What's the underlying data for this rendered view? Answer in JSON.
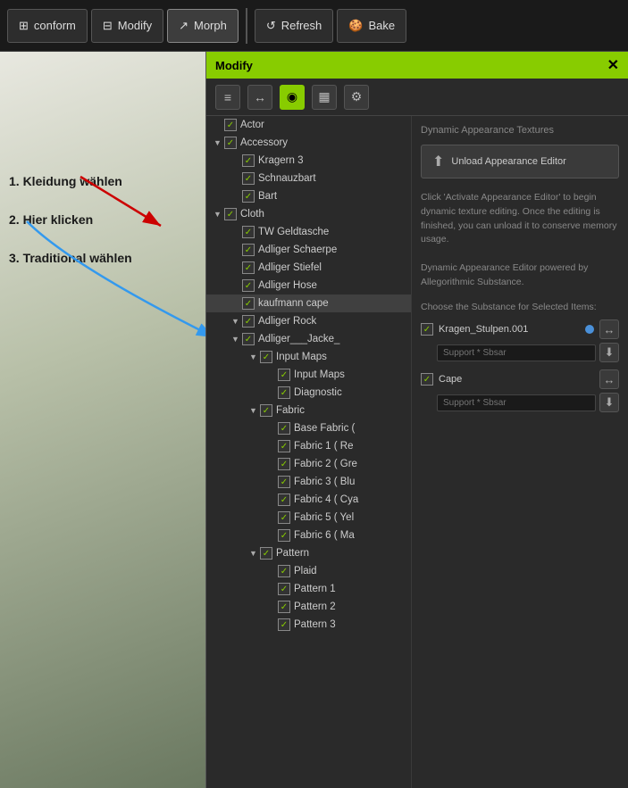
{
  "toolbar": {
    "conform_label": "conform",
    "modify_label": "Modify",
    "morph_label": "Morph",
    "refresh_label": "Refresh",
    "bake_label": "Bake"
  },
  "modify_panel": {
    "title": "Modify",
    "close_icon": "✕",
    "sub_icons": [
      "⊞",
      "↔",
      "◉",
      "▦",
      "⚙"
    ]
  },
  "instructions": {
    "step1": "1. Kleidung wählen",
    "step2": "2. Hier klicken",
    "step3": "3. Traditional wählen"
  },
  "tree": {
    "items": [
      {
        "label": "Actor",
        "level": 0,
        "checked": true,
        "expandable": false
      },
      {
        "label": "Accessory",
        "level": 0,
        "checked": true,
        "expandable": true
      },
      {
        "label": "Kragern 3",
        "level": 1,
        "checked": true,
        "expandable": false
      },
      {
        "label": "Schnauzbart",
        "level": 1,
        "checked": true,
        "expandable": false
      },
      {
        "label": "Bart",
        "level": 1,
        "checked": true,
        "expandable": false
      },
      {
        "label": "Cloth",
        "level": 0,
        "checked": true,
        "expandable": true
      },
      {
        "label": "TW Geldtasche",
        "level": 1,
        "checked": true,
        "expandable": false
      },
      {
        "label": "Adliger Schaerpe",
        "level": 1,
        "checked": true,
        "expandable": false
      },
      {
        "label": "Adliger Stiefel",
        "level": 1,
        "checked": true,
        "expandable": false
      },
      {
        "label": "Adliger Hose",
        "level": 1,
        "checked": true,
        "expandable": false
      },
      {
        "label": "kaufmann cape",
        "level": 1,
        "checked": true,
        "expandable": false,
        "selected": true
      },
      {
        "label": "Adliger Rock",
        "level": 1,
        "checked": true,
        "expandable": true
      },
      {
        "label": "Adliger___Jacke_",
        "level": 2,
        "checked": true,
        "expandable": true
      },
      {
        "label": "Input Maps",
        "level": 3,
        "checked": true,
        "expandable": true
      },
      {
        "label": "Input Maps",
        "level": 4,
        "checked": true,
        "expandable": false
      },
      {
        "label": "Diagnostic",
        "level": 4,
        "checked": true,
        "expandable": false
      },
      {
        "label": "Fabric",
        "level": 3,
        "checked": true,
        "expandable": true
      },
      {
        "label": "Base Fabric (",
        "level": 4,
        "checked": true,
        "expandable": false
      },
      {
        "label": "Fabric 1 ( Re",
        "level": 4,
        "checked": true,
        "expandable": false
      },
      {
        "label": "Fabric 2 ( Gre",
        "level": 4,
        "checked": true,
        "expandable": false
      },
      {
        "label": "Fabric 3 ( Blu",
        "level": 4,
        "checked": true,
        "expandable": false
      },
      {
        "label": "Fabric 4 ( Cya",
        "level": 4,
        "checked": true,
        "expandable": false
      },
      {
        "label": "Fabric 5 ( Yel",
        "level": 4,
        "checked": true,
        "expandable": false
      },
      {
        "label": "Fabric 6 ( Ma",
        "level": 4,
        "checked": true,
        "expandable": false
      },
      {
        "label": "Pattern",
        "level": 3,
        "checked": true,
        "expandable": true
      },
      {
        "label": "Plaid",
        "level": 4,
        "checked": true,
        "expandable": false
      },
      {
        "label": "Pattern 1",
        "level": 4,
        "checked": true,
        "expandable": false
      },
      {
        "label": "Pattern 2",
        "level": 4,
        "checked": true,
        "expandable": false
      },
      {
        "label": "Pattern 3",
        "level": 4,
        "checked": true,
        "expandable": false
      }
    ]
  },
  "right_panel": {
    "section_title": "Dynamic Appearance Textures",
    "unload_btn_label": "Unload Appearance Editor",
    "info_text": "Click 'Activate Appearance Editor' to begin dynamic texture editing. Once the editing is finished, you can unload it to conserve memory usage.\n\nDynamic Appearance Editor powered by Allegorithmic Substance.",
    "substance_label": "Choose the Substance for Selected Items:",
    "substances": [
      {
        "name": "Kragen_Stulpen.001",
        "checked": true,
        "has_dot": true
      },
      {
        "name": "Cape",
        "checked": true,
        "has_dot": false
      }
    ],
    "support_placeholder": "Support * Sbsar",
    "download_icon": "⬇"
  }
}
